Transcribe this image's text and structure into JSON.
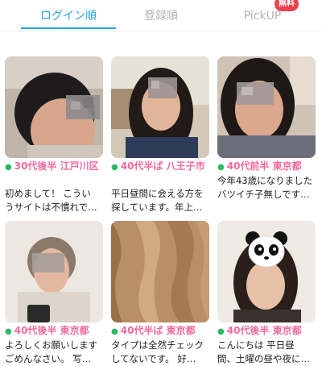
{
  "tabs": [
    {
      "label": "ログイン順",
      "active": true
    },
    {
      "label": "登録順",
      "active": false
    },
    {
      "label": "PickUP",
      "active": false,
      "badge": "無料"
    }
  ],
  "accent_color": "#2aa3e8",
  "age_label_color": "#f06a9c",
  "online_dot_color": "#2fb866",
  "profiles": [
    {
      "age_location": "30代後半 江戸川区",
      "bio_line1": "初めまして！ こうい",
      "bio_line2": "うサイトは不慣れで…",
      "online": true
    },
    {
      "age_location": "40代半ば 八王子市",
      "bio_line1": "平日昼間に会える方を",
      "bio_line2": "探しています。年上…",
      "online": true
    },
    {
      "age_location": "40代前半 東京都",
      "bio_line1": "今年43歳になりました",
      "bio_line2": "バツイチ子無しです…",
      "online": true
    },
    {
      "age_location": "40代後半 東京都",
      "bio_line1": "よろしくお願いします",
      "bio_line2": "ごめんなさい。 写…",
      "online": true
    },
    {
      "age_location": "40代半ば 東京都",
      "bio_line1": "タイプは全然チェック",
      "bio_line2": "してないです。 好…",
      "online": true
    },
    {
      "age_location": "40代後半 東京都",
      "bio_line1": "こんにちは 平日昼",
      "bio_line2": "間、土曜の昼や夜に…",
      "online": true
    }
  ]
}
